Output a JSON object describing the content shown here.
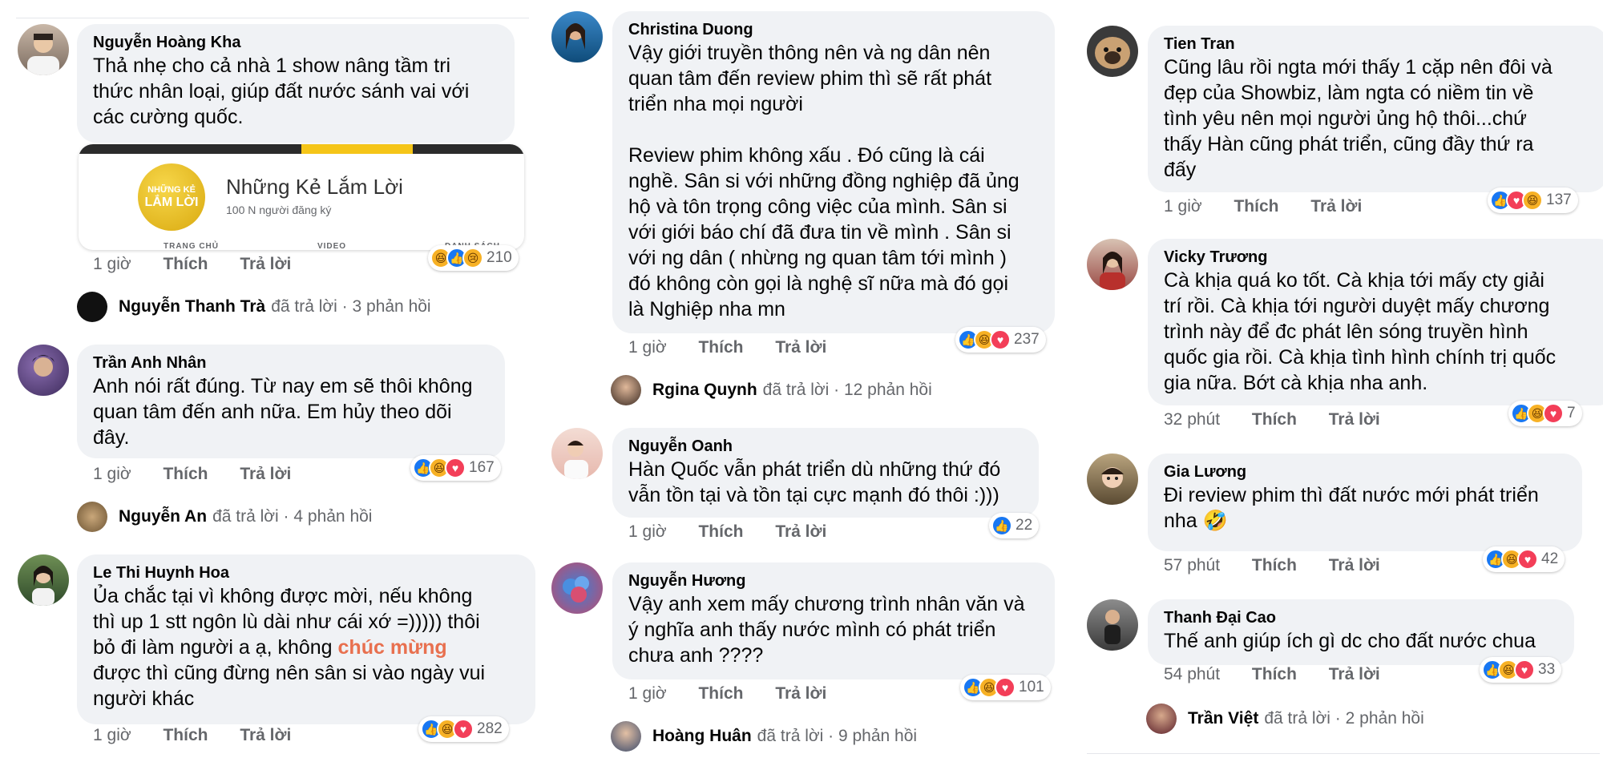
{
  "colors": {
    "bubble": "#f0f2f5",
    "meta": "#65676b",
    "like": "#1877f2",
    "love": "#f33e58",
    "haha": "#f7b125",
    "highlight": "#e8704f"
  },
  "actions": {
    "like": "Thích",
    "reply": "Trả lời"
  },
  "replied_text": "đã trả lời",
  "columns": [
    {
      "comments": [
        {
          "name": "Nguyễn Hoàng Kha",
          "text": "Thả nhẹ cho cả nhà 1 show nâng tầm tri\nthức nhân loại, giúp đất nước sánh vai với\ncác cường quốc.",
          "time": "1 giờ",
          "reactions": [
            "haha-icon",
            "like-icon",
            "sad-icon"
          ],
          "count": "210",
          "link_card": {
            "logo_top": "NHỮNG KẺ",
            "logo_bottom": "LẮM LỜI",
            "title": "Những Kẻ Lắm Lời",
            "subtitle": "100 N người đăng ký",
            "tabs": [
              "TRANG CHỦ",
              "VIDEO",
              "DANH SÁCH"
            ]
          },
          "reply": {
            "name": "Nguyễn Thanh Trà",
            "count": "3 phản hồi"
          }
        },
        {
          "name": "Trần Anh Nhân",
          "text": "Anh nói rất đúng. Từ nay em sẽ thôi không\nquan tâm đến anh nữa. Em hủy theo dõi\nđây.",
          "time": "1 giờ",
          "reactions": [
            "like-icon",
            "haha-icon",
            "love-icon"
          ],
          "count": "167",
          "reply": {
            "name": "Nguyễn An",
            "count": "4 phản hồi"
          }
        },
        {
          "name": "Le Thi Huynh Hoa",
          "text_before": "Ủa chắc tại vì không được mời, nếu không\nthì up 1 stt ngôn lù dài như cái xớ =))))) thôi\nbỏ đi làm người a ạ, không ",
          "highlight": "chúc mừng",
          "text_after": "\nđược thì cũng đừng nên sân si vào ngày vui\nngười khác",
          "time": "1 giờ",
          "reactions": [
            "like-icon",
            "haha-icon",
            "love-icon"
          ],
          "count": "282"
        }
      ]
    },
    {
      "comments": [
        {
          "name": "Christina Duong",
          "text": "Vậy giới truyền thông nên và ng dân nên\nquan tâm đến review phim thì sẽ rất phát\ntriển nha mọi người\n\nReview phim không xấu . Đó cũng là cái\nnghề. Sân si với những đồng nghiệp đã ủng\nhộ và tôn trọng công việc của mình. Sân si\nvới giới báo chí đã đưa tin về mình . Sân si\nvới ng dân ( nhừng ng quan tâm tới mình )\nđó không còn gọi là nghệ sĩ nữa mà đó gọi\nlà Nghiệp nha mn",
          "time": "1 giờ",
          "reactions": [
            "like-icon",
            "haha-icon",
            "love-icon"
          ],
          "count": "237",
          "reply": {
            "name": "Rgina Quynh",
            "count": "12 phản hồi"
          }
        },
        {
          "name": "Nguyễn Oanh",
          "text": "Hàn Quốc vẫn phát triển dù những thứ đó\nvẫn tồn tại và tồn tại cực mạnh đó thôi :)))",
          "time": "1 giờ",
          "reactions": [
            "like-icon"
          ],
          "count": "22"
        },
        {
          "name": "Nguyễn Hương",
          "text": "Vậy anh xem mấy chương trình nhân văn và\ný nghĩa anh thấy nước mình có phát triển\nchưa anh ????",
          "time": "1 giờ",
          "reactions": [
            "like-icon",
            "haha-icon",
            "love-icon"
          ],
          "count": "101",
          "reply": {
            "name": "Hoàng Huân",
            "count": "9 phản hồi"
          }
        }
      ]
    },
    {
      "comments": [
        {
          "name": "Tien Tran",
          "text": "Cũng lâu rồi ngta mới thấy 1 cặp nên đôi và\nđẹp của Showbiz, làm ngta có niềm tin về\ntình yêu nên mọi người ủng hộ thôi...chứ\nthấy Hàn cũng phát triển, cũng đầy thứ ra\nđấy",
          "time": "1 giờ",
          "reactions": [
            "like-icon",
            "love-icon",
            "haha-icon"
          ],
          "count": "137"
        },
        {
          "name": "Vicky Trương",
          "text": "Cà khịa quá ko tốt. Cà khịa tới mấy cty giải\ntrí rồi. Cà khịa tới người duyệt mấy chương\ntrình này để đc phát lên sóng truyền hình\nquốc gia rồi. Cà khịa tình hình chính trị quốc\ngia nữa. Bớt cà khịa nha anh.",
          "time": "32 phút",
          "reactions": [
            "like-icon",
            "haha-icon",
            "love-icon"
          ],
          "count": "7"
        },
        {
          "name": "Gia Lương",
          "text": "Đi review phim thì đất nước mới phát triển\nnha 🤣",
          "time": "57 phút",
          "reactions": [
            "like-icon",
            "haha-icon",
            "love-icon"
          ],
          "count": "42"
        },
        {
          "name": "Thanh Đại Cao",
          "text": "Thế anh giúp ích gì dc cho đất nước chua",
          "time": "54 phút",
          "reactions": [
            "like-icon",
            "haha-icon",
            "love-icon"
          ],
          "count": "33",
          "reply": {
            "name": "Trần Việt",
            "count": "2 phản hồi"
          }
        }
      ]
    }
  ]
}
